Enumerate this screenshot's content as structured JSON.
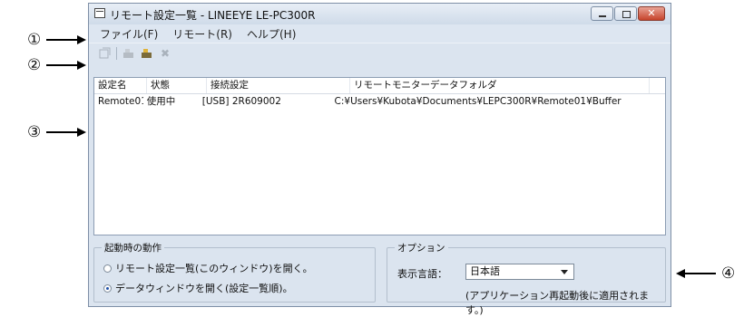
{
  "callouts": {
    "c1": "①",
    "c2": "②",
    "c3": "③",
    "c4": "④"
  },
  "window": {
    "title": "リモート設定一覧 - LINEEYE LE-PC300R"
  },
  "menu": [
    "ファイル(F)",
    "リモート(R)",
    "ヘルプ(H)"
  ],
  "list": {
    "headers": [
      "設定名",
      "状態",
      "接続設定",
      "リモートモニターデータフォルダ"
    ],
    "rows": [
      [
        "Remote01",
        "使用中",
        "[USB] 2R609002",
        "C:¥Users¥Kubota¥Documents¥LEPC300R¥Remote01¥Buffer"
      ]
    ]
  },
  "startup": {
    "title": "起動時の動作",
    "option1": "リモート設定一覧(このウィンドウ)を開く。",
    "option2": "データウィンドウを開く(設定一覧順)。",
    "selected": 2
  },
  "options": {
    "title": "オプション",
    "language_label": "表示言語：",
    "language_value": "日本語",
    "note": "(アプリケーション再起動後に適用されます。)"
  }
}
